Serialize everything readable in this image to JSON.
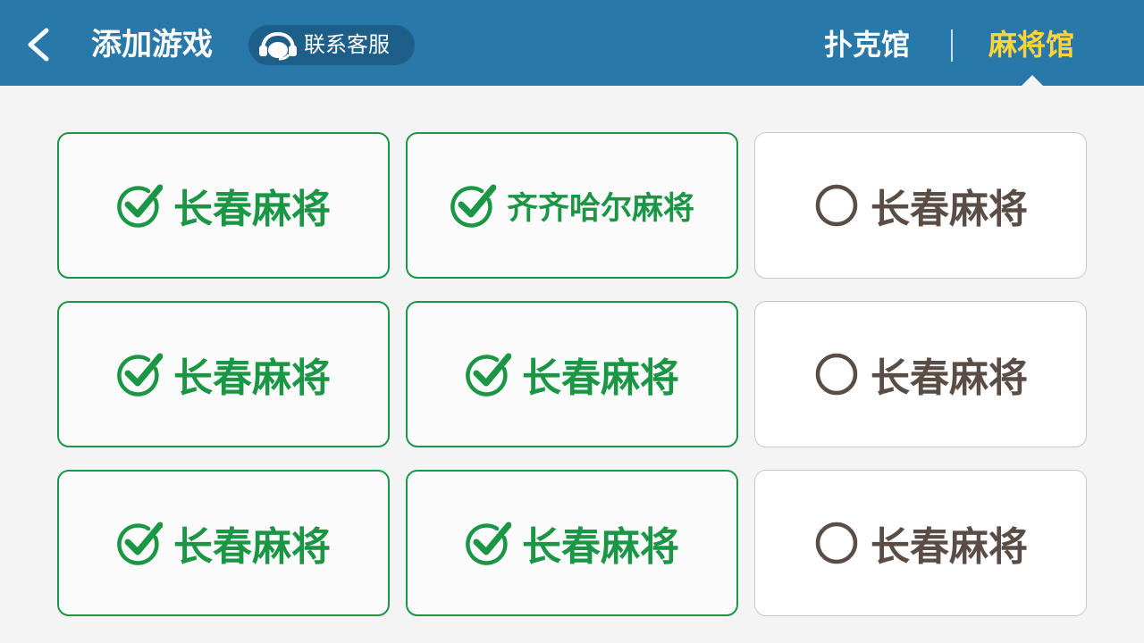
{
  "header": {
    "title": "添加游戏",
    "support_label": "联系客服",
    "tabs": [
      {
        "label": "扑克馆",
        "active": false
      },
      {
        "label": "麻将馆",
        "active": true
      }
    ],
    "colors": {
      "bar": "#2878aa",
      "active_tab": "#ffd53a"
    }
  },
  "games": [
    {
      "name": "长春麻将",
      "selected": true
    },
    {
      "name": "齐齐哈尔麻将",
      "selected": true
    },
    {
      "name": "长春麻将",
      "selected": false
    },
    {
      "name": "长春麻将",
      "selected": true
    },
    {
      "name": "长春麻将",
      "selected": true
    },
    {
      "name": "长春麻将",
      "selected": false
    },
    {
      "name": "长春麻将",
      "selected": true
    },
    {
      "name": "长春麻将",
      "selected": true
    },
    {
      "name": "长春麻将",
      "selected": false
    }
  ],
  "icons": {
    "back": "chevron-left-icon",
    "support": "headset-icon",
    "selected": "check-circle-icon",
    "unselected": "empty-circle-icon"
  },
  "colors": {
    "selected": "#1a9645",
    "unselected": "#5a4d46"
  }
}
